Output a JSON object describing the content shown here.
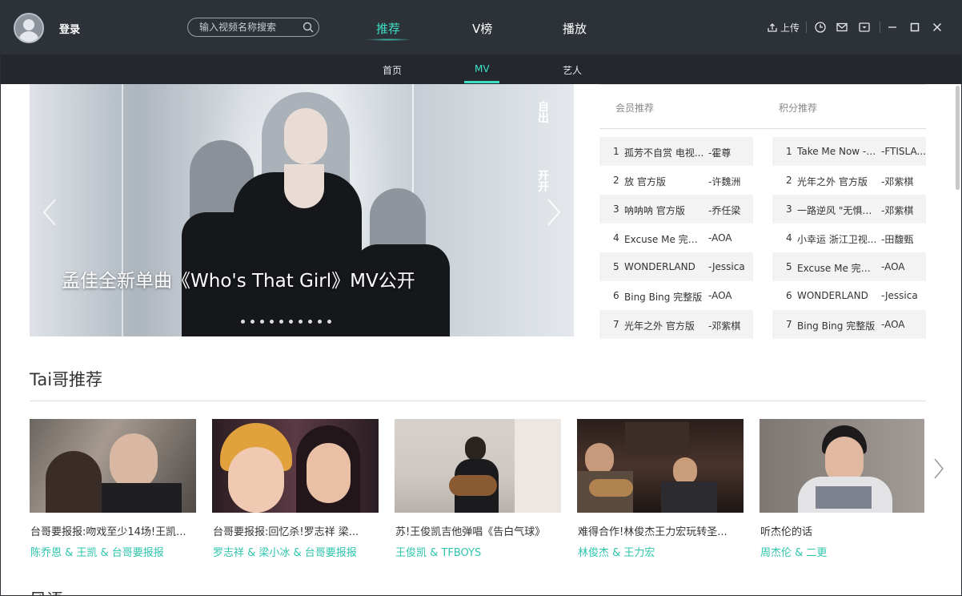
{
  "header": {
    "login_label": "登录",
    "search_placeholder": "输入视频名称搜索",
    "nav": [
      {
        "label": "推荐",
        "active": true
      },
      {
        "label": "V榜",
        "active": false
      },
      {
        "label": "播放",
        "active": false
      }
    ],
    "upload_label": "上传"
  },
  "subnav": {
    "items": [
      {
        "label": "首页",
        "active": false
      },
      {
        "label": "MV",
        "active": true
      },
      {
        "label": "艺人",
        "active": false
      }
    ]
  },
  "banner": {
    "caption": "孟佳全新单曲《Who's That Girl》MV公开",
    "side_text_1": "自出",
    "side_text_2": "开开",
    "dot_count": 10
  },
  "ranks": {
    "tab_member": "会员推荐",
    "tab_points": "积分推荐",
    "member": [
      {
        "num": "1",
        "title": "孤芳不自赏 电视...",
        "artist": "-霍尊"
      },
      {
        "num": "2",
        "title": "放 官方版",
        "artist": "-许魏洲"
      },
      {
        "num": "3",
        "title": "呐呐呐 官方版",
        "artist": "-乔任梁"
      },
      {
        "num": "4",
        "title": "Excuse Me 完整版",
        "artist": "-AOA"
      },
      {
        "num": "5",
        "title": "WONDERLAND",
        "artist": "-Jessica"
      },
      {
        "num": "6",
        "title": "Bing Bing 完整版",
        "artist": "-AOA"
      },
      {
        "num": "7",
        "title": "光年之外 官方版",
        "artist": "-邓紫棋"
      }
    ],
    "points": [
      {
        "num": "1",
        "title": "Take Me Now - ...",
        "artist": "-FTISLA..."
      },
      {
        "num": "2",
        "title": "光年之外 官方版",
        "artist": "-邓紫棋"
      },
      {
        "num": "3",
        "title": "一路逆风 \"无惧风...",
        "artist": "-邓紫棋"
      },
      {
        "num": "4",
        "title": "小幸运 浙江卫视...",
        "artist": "-田馥甄"
      },
      {
        "num": "5",
        "title": "Excuse Me 完整版",
        "artist": "-AOA"
      },
      {
        "num": "6",
        "title": "WONDERLAND",
        "artist": "-Jessica"
      },
      {
        "num": "7",
        "title": "Bing Bing 完整版",
        "artist": "-AOA"
      }
    ]
  },
  "section": {
    "title": "Tai哥推荐",
    "next_title": "风语"
  },
  "cards": [
    {
      "title": "台哥要报报:吻戏至少14场!王凯...",
      "artists": "陈乔恩 & 王凯 & 台哥要报报"
    },
    {
      "title": "台哥要报报:回忆杀!罗志祥 梁...",
      "artists": "罗志祥 & 梁小冰 & 台哥要报报"
    },
    {
      "title": "苏!王俊凯吉他弹唱《告白气球》",
      "artists": "王俊凯 & TFBOYS"
    },
    {
      "title": "难得合作!林俊杰王力宏玩转圣...",
      "artists": "林俊杰 & 王力宏"
    },
    {
      "title": "听杰伦的话",
      "artists": "周杰伦 & 二更"
    }
  ],
  "colors": {
    "accent": "#3ee0c5",
    "artist_link": "#2fc5ad",
    "titlebar_bg": "#2d3138",
    "subnav_bg": "#24282e"
  }
}
